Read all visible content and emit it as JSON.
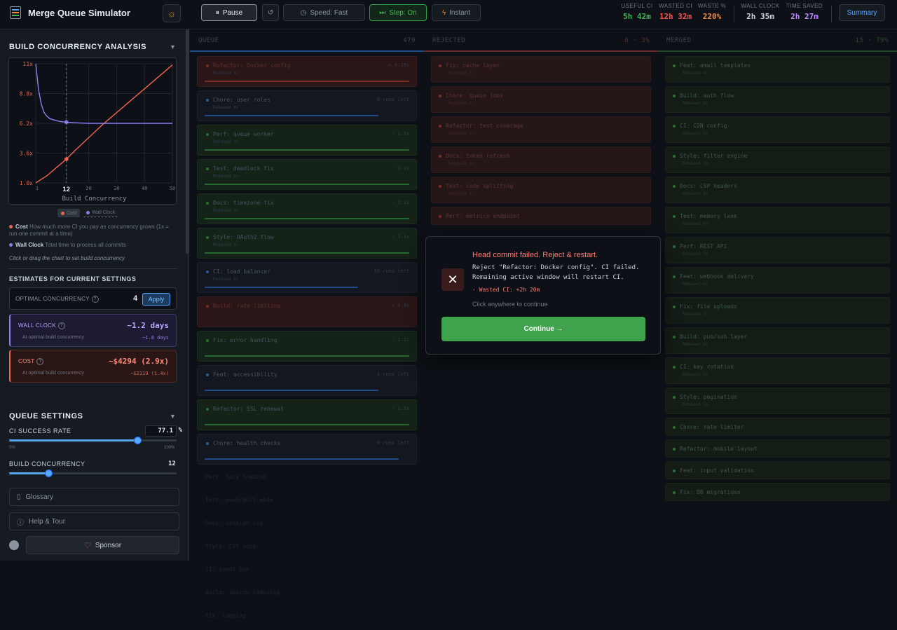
{
  "header": {
    "title": "Merge Queue Simulator",
    "buttons": {
      "pause": "Pause",
      "speed": "Speed: Fast",
      "step": "Step: On",
      "instant": "Instant",
      "summary": "Summary"
    },
    "stats": [
      {
        "label": "USEFUL CI",
        "value": "5h 42m"
      },
      {
        "label": "WASTED CI",
        "value": "12h 32m"
      },
      {
        "label": "WASTE %",
        "value": "220%"
      },
      {
        "label": "WALL CLOCK",
        "value": "2h 35m"
      },
      {
        "label": "TIME SAVED",
        "value": "2h 27m"
      }
    ]
  },
  "sidebar": {
    "analysis_title": "BUILD CONCURRENCY ANALYSIS",
    "legend": {
      "cost": "Cost",
      "wall": "Wall Clock"
    },
    "cost_desc_label": "Cost",
    "cost_desc": "How much more CI you pay as concurrency grows (1x = run one commit at a time)",
    "wall_desc_label": "Wall Clock",
    "wall_desc": "Total time to process all commits",
    "click_hint": "Click or drag the chart to set build concurrency",
    "estimates_title": "ESTIMATES FOR CURRENT SETTINGS",
    "optimal_label": "OPTIMAL CONCURRENCY",
    "optimal_value": "4",
    "apply": "Apply",
    "wall_card": {
      "name": "WALL CLOCK",
      "value": "~1.2 days",
      "sub": "At optimal build concurrency",
      "small": "~1.8 days"
    },
    "cost_card": {
      "name": "COST",
      "value": "~$4294 (2.9x)",
      "sub": "At optimal build concurrency",
      "small": "~$2119 (1.4x)"
    },
    "queue_settings_title": "QUEUE SETTINGS",
    "ci_rate_label": "CI SUCCESS RATE",
    "ci_rate_value": "77.1",
    "ci_rate_unit": "%",
    "ci_rate_min": "0%",
    "ci_rate_max": "100%",
    "ci_rate_fraction": 0.771,
    "bc_label": "BUILD CONCURRENCY",
    "bc_value": "12",
    "bc_fraction": 0.24,
    "glossary": "Glossary",
    "help": "Help & Tour",
    "sponsor": "Sponsor"
  },
  "chart_data": {
    "type": "line",
    "xlabel": "Build Concurrency",
    "x_ticks": [
      "1",
      "12",
      "20",
      "30",
      "40",
      "50"
    ],
    "y_ticks": [
      "1.0x",
      "3.6x",
      "6.2x",
      "8.8x",
      "11x"
    ],
    "xlim": [
      1,
      50
    ],
    "ylim": [
      1,
      11
    ],
    "selected_x": 12,
    "series": [
      {
        "name": "Cost",
        "color": "#f0634f",
        "x": [
          1,
          5,
          10,
          12,
          15,
          20,
          25,
          30,
          35,
          40,
          45,
          50
        ],
        "y": [
          1.0,
          1.6,
          2.6,
          3.0,
          3.7,
          4.8,
          5.9,
          6.9,
          7.9,
          8.9,
          9.9,
          10.9
        ]
      },
      {
        "name": "Wall Clock",
        "color": "#8b7ff0",
        "x": [
          1,
          2,
          3,
          4,
          5,
          6,
          8,
          10,
          12,
          15,
          20,
          30,
          40,
          50
        ],
        "y": [
          11.0,
          8.8,
          7.6,
          6.9,
          6.6,
          6.4,
          6.25,
          6.15,
          6.1,
          6.05,
          6.0,
          6.0,
          6.0,
          6.0
        ]
      }
    ]
  },
  "columns": {
    "queue": {
      "title": "QUEUE",
      "count": "479"
    },
    "rejected": {
      "title": "REJECTED",
      "count": "6 · 3%"
    },
    "merged": {
      "title": "MERGED",
      "count": "15 · 79%"
    }
  },
  "queue_cards": [
    {
      "title": "Refactor: Docker config",
      "sub": "Rebased 3×",
      "meta": "✕ 0:19s",
      "state": "fail",
      "progress": 1.0
    },
    {
      "title": "Chore: user roles",
      "sub": "Rebased 4×",
      "meta": "8 runs left",
      "state": "run",
      "progress": 0.85
    },
    {
      "title": "Perf: queue worker",
      "sub": "Rebased 2×",
      "meta": "✓ 1:1s",
      "state": "pass",
      "progress": 1.0
    },
    {
      "title": "Test: deadlock fix",
      "sub": "Rebased 5×",
      "meta": "✓ 1:1s",
      "state": "pass",
      "progress": 1.0
    },
    {
      "title": "Docs: timezone fix",
      "sub": "Rebased 3×",
      "meta": "✓ 1:1s",
      "state": "pass",
      "progress": 1.0
    },
    {
      "title": "Style: OAuth2 flow",
      "sub": "Rebased 3×",
      "meta": "✓ 1:1s",
      "state": "pass",
      "progress": 1.0
    },
    {
      "title": "CI: load balancer",
      "sub": "Rebased 5×",
      "meta": "10 runs left",
      "state": "run",
      "progress": 0.75
    },
    {
      "title": "Build: rate limiting",
      "sub": "",
      "meta": "✕ 0:9s",
      "state": "fail",
      "progress": 0
    },
    {
      "title": "Fix: error handling",
      "sub": "",
      "meta": "✓ 1:1s",
      "state": "pass",
      "progress": 1.0
    },
    {
      "title": "Feat: accessibility",
      "sub": "",
      "meta": "4 runs left",
      "state": "run",
      "progress": 0.85
    },
    {
      "title": "Refactor: SSL renewal",
      "sub": "",
      "meta": "✓ 1:1s",
      "state": "pass",
      "progress": 1.0
    },
    {
      "title": "Chore: health checks",
      "sub": "",
      "meta": "6 runs left",
      "state": "run",
      "progress": 0.95
    }
  ],
  "queue_ghosts": [
    "Perf: lazy loading",
    "Test: push/pull mode",
    "Docs: session log",
    "Style: CSS song",
    "CI: event bus",
    "Build: search indexing",
    "Fix: logging"
  ],
  "rejected_cards": [
    {
      "title": "Fix: cache layer",
      "sub": "Rebased 2×"
    },
    {
      "title": "Chore: queue jobs",
      "sub": "Rebased 4×"
    },
    {
      "title": "Refactor: test coverage",
      "sub": "Rebased 2×"
    },
    {
      "title": "Docs: token refresh",
      "sub": "Rebased 3×"
    },
    {
      "title": "Test: code splitting",
      "sub": "Rebased 2×"
    },
    {
      "title": "Perf: metrics endpoint",
      "sub": ""
    }
  ],
  "merged_cards": [
    {
      "title": "Feat: email templates",
      "sub": "Rebased 4×"
    },
    {
      "title": "Build: auth flow",
      "sub": "Rebased 3×"
    },
    {
      "title": "CI: CDN config",
      "sub": "Rebased 2×"
    },
    {
      "title": "Style: filter engine",
      "sub": "Rebased 2×"
    },
    {
      "title": "Docs: CSP headers",
      "sub": "Rebased 4×"
    },
    {
      "title": "Test: memory leak",
      "sub": "Rebased 6×"
    },
    {
      "title": "Perf: REST API",
      "sub": "Rebased 3×"
    },
    {
      "title": "Feat: webhook delivery",
      "sub": "Rebased 6×"
    },
    {
      "title": "Fix: file uploads",
      "sub": "Rebased 3×"
    },
    {
      "title": "Build: pub/sub layer",
      "sub": "Rebased 3×"
    },
    {
      "title": "CI: key rotation",
      "sub": "Rebased 3×"
    },
    {
      "title": "Style: pagination",
      "sub": "Rebased 3×"
    },
    {
      "title": "Chore: rate limiter",
      "sub": ""
    },
    {
      "title": "Refactor: mobile layout",
      "sub": ""
    },
    {
      "title": "Feat: input validation",
      "sub": ""
    },
    {
      "title": "Fix: DB migrations",
      "sub": ""
    }
  ],
  "modal": {
    "title": "Head commit failed. Reject & restart.",
    "desc": "Reject \"Refactor: Docker config\". CI failed. Remaining active window will restart CI.",
    "wasted": "· Wasted CI: +2h 20m",
    "hint": "Click anywhere to continue",
    "button": "Continue →"
  },
  "colors": {
    "accent": "#58a6ff",
    "success": "#3fb950",
    "danger": "#f85149",
    "cost": "#f0634f",
    "wall": "#8b7ff0"
  }
}
